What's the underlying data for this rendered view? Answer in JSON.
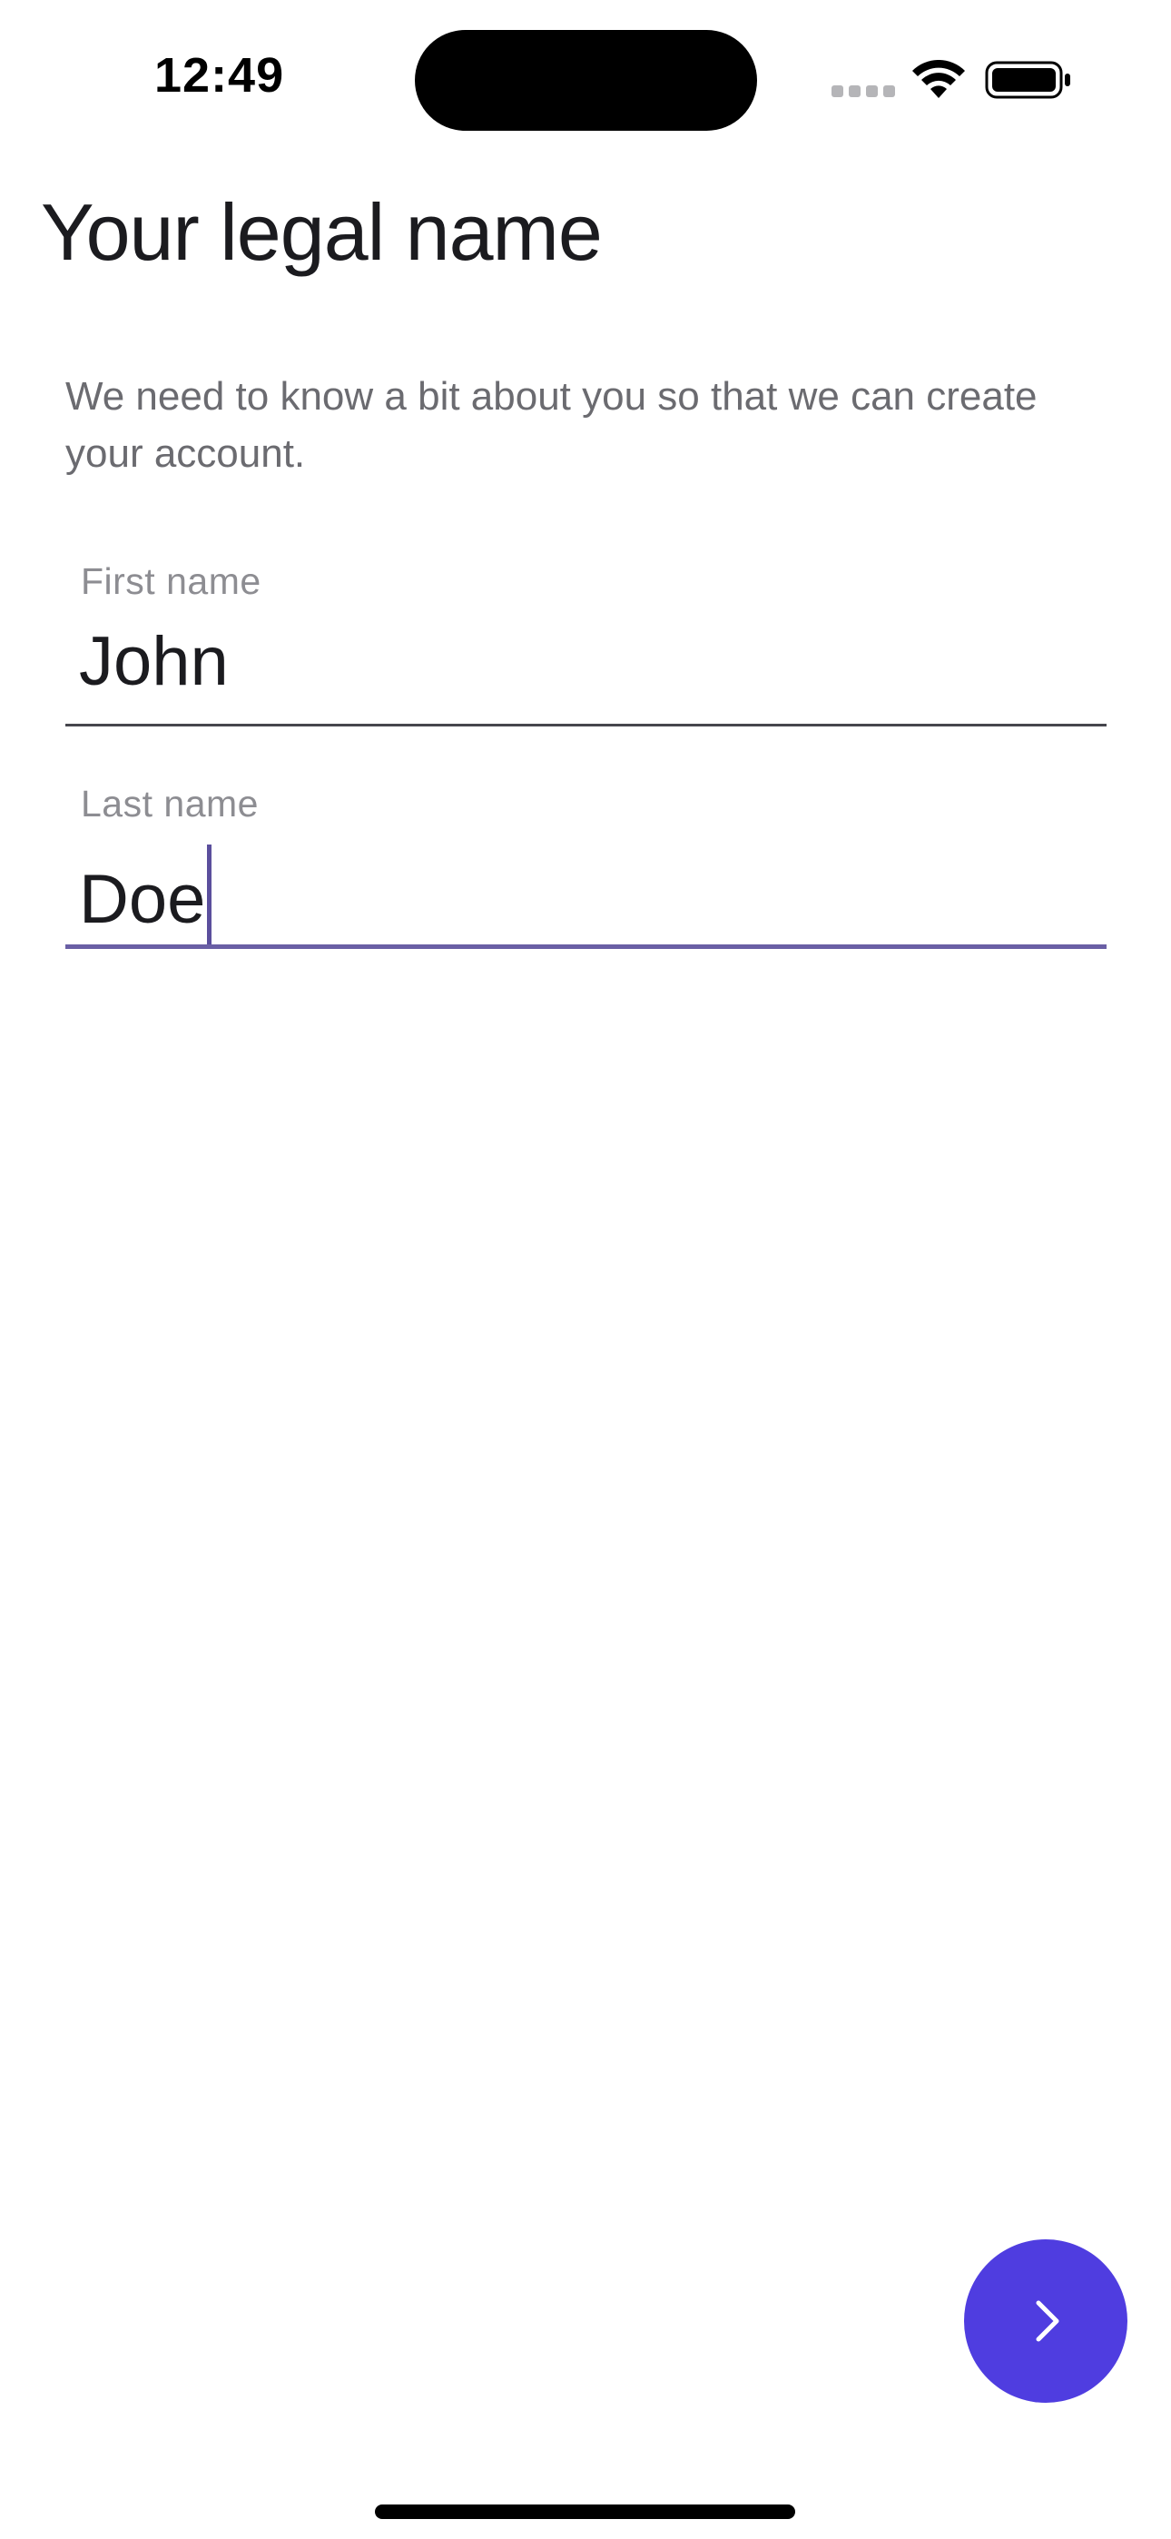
{
  "status_bar": {
    "time": "12:49",
    "icons": [
      "cellular-signal-icon",
      "wifi-icon",
      "battery-icon"
    ]
  },
  "page": {
    "title": "Your legal name",
    "subtitle": "We need to know a bit about you so that we can create your account."
  },
  "form": {
    "first_name": {
      "label": "First name",
      "value": "John"
    },
    "last_name": {
      "label": "Last name",
      "value": "Doe",
      "focused": true
    }
  },
  "fab": {
    "icon": "chevron-right-icon"
  },
  "colors": {
    "accent": "#4f3de0",
    "focus_underline": "#6a5fa5",
    "title": "#1b1b1f",
    "subtitle": "#6b6b70",
    "label": "#8d8d92"
  }
}
